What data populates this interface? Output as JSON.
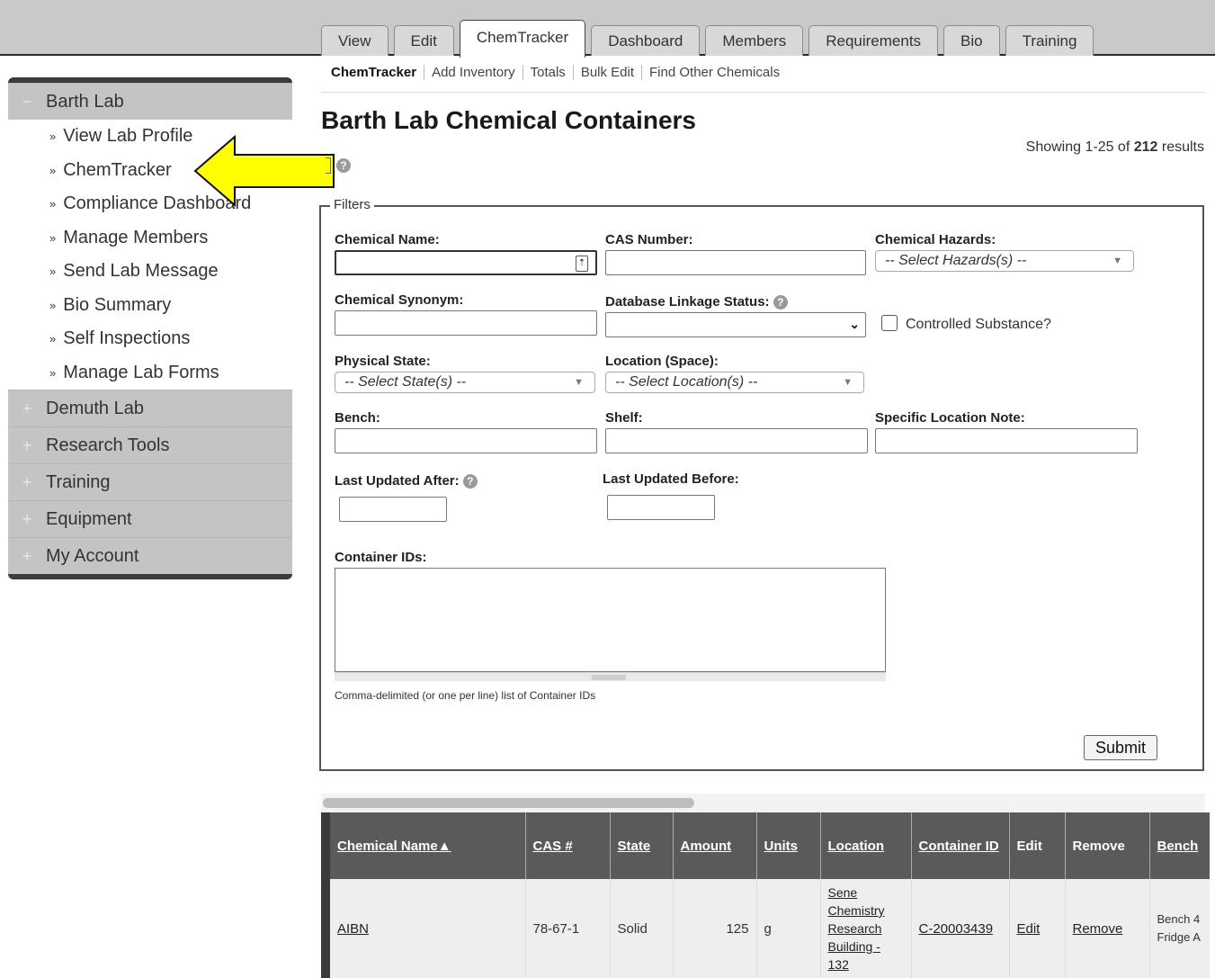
{
  "tabs": [
    {
      "label": "View"
    },
    {
      "label": "Edit"
    },
    {
      "label": "ChemTracker"
    },
    {
      "label": "Dashboard"
    },
    {
      "label": "Members"
    },
    {
      "label": "Requirements"
    },
    {
      "label": "Bio"
    },
    {
      "label": "Training"
    }
  ],
  "sidebar": {
    "open_section": {
      "symbol": "−",
      "label": "Barth Lab"
    },
    "items": [
      {
        "label": "View Lab Profile"
      },
      {
        "label": "ChemTracker"
      },
      {
        "label": "Compliance Dashboard"
      },
      {
        "label": "Manage Members"
      },
      {
        "label": "Send Lab Message"
      },
      {
        "label": "Bio Summary"
      },
      {
        "label": "Self Inspections"
      },
      {
        "label": "Manage Lab Forms"
      }
    ],
    "collapsed_sections": [
      {
        "symbol": "+",
        "label": "Demuth Lab"
      },
      {
        "symbol": "+",
        "label": "Research Tools"
      },
      {
        "symbol": "+",
        "label": "Training"
      },
      {
        "symbol": "+",
        "label": "Equipment"
      },
      {
        "symbol": "+",
        "label": "My Account"
      }
    ],
    "bullet": "»"
  },
  "annotation_arrow_color": "#ffff00",
  "subnav": [
    "ChemTracker",
    "Add Inventory",
    "Totals",
    "Bulk Edit",
    "Find Other Chemicals"
  ],
  "page": {
    "title": "Barth Lab Chemical Containers",
    "showing_prefix": "Showing 1-25 of ",
    "showing_total": "212",
    "showing_suffix": " results"
  },
  "filters": {
    "legend": "Filters",
    "chemical_name": "Chemical Name:",
    "cas_number": "CAS Number:",
    "chemical_hazards": "Chemical Hazards:",
    "hazards_placeholder": "-- Select Hazards(s) --",
    "chemical_synonym": "Chemical Synonym:",
    "db_linkage": "Database Linkage Status:",
    "controlled": "Controlled Substance?",
    "physical_state": "Physical State:",
    "state_placeholder": "-- Select State(s) --",
    "location_space": "Location (Space):",
    "location_placeholder": "-- Select Location(s) --",
    "bench": "Bench:",
    "shelf": "Shelf:",
    "specific_location": "Specific Location Note:",
    "last_updated_after": "Last Updated After:",
    "last_updated_before": "Last Updated Before:",
    "container_ids": "Container IDs:",
    "container_hint": "Comma-delimited (or one per line) list of Container IDs",
    "submit": "Submit"
  },
  "table": {
    "headers": [
      "Chemical Name▲",
      "CAS #",
      "State",
      "Amount",
      "Units",
      "Location",
      "Container ID",
      "Edit",
      "Remove",
      "Bench"
    ],
    "rows": [
      {
        "name": "AIBN",
        "cas": "78-67-1",
        "state": "Solid",
        "amount": "125",
        "units": "g",
        "location": "Sene Chemistry Research Building - 132",
        "container_id": "C-20003439",
        "edit": "Edit",
        "remove": "Remove",
        "bench": "Bench 4 Fridge A"
      }
    ]
  }
}
